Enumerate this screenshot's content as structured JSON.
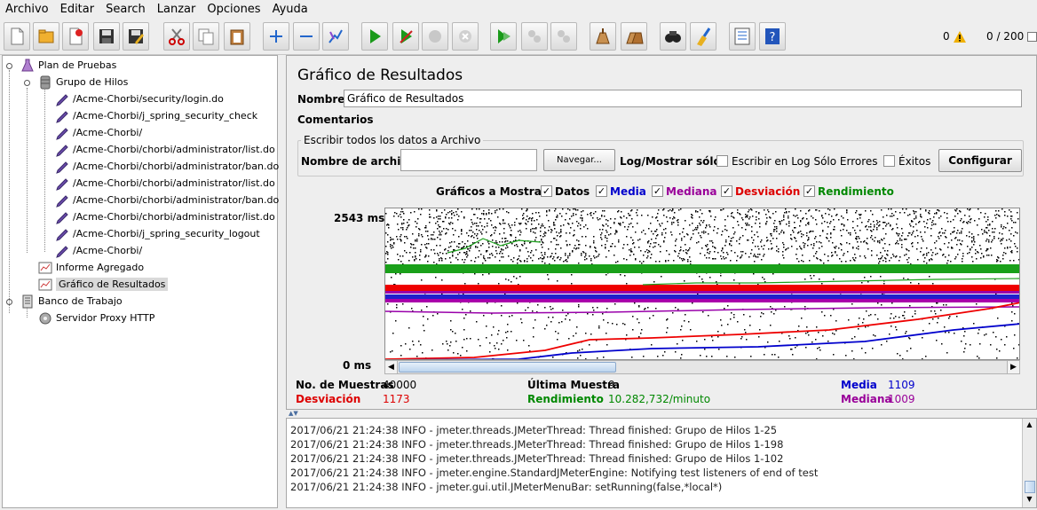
{
  "menu": [
    {
      "label": "Archivo"
    },
    {
      "label": "Editar"
    },
    {
      "label": "Search"
    },
    {
      "label": "Lanzar"
    },
    {
      "label": "Opciones"
    },
    {
      "label": "Ayuda"
    }
  ],
  "toolbar": {
    "icons": [
      "new-icon",
      "open-icon",
      "close-file-icon",
      "save-icon",
      "save-as-icon",
      "cut-icon",
      "copy-icon",
      "paste-icon",
      "expand-icon",
      "collapse-icon",
      "toggle-icon",
      "start-icon",
      "start-no-pause-icon",
      "stop-icon",
      "shutdown-icon",
      "remote-start-icon",
      "remote-stop-icon",
      "remote-shutdown-icon",
      "clear-icon",
      "clear-all-icon",
      "search-icon",
      "reset-search-icon",
      "function-helper-icon",
      "help-icon"
    ],
    "warning_count": "0",
    "threads": "0 / 200"
  },
  "tree": {
    "items": [
      {
        "label": "Plan de Pruebas",
        "icon": "test-plan-icon"
      },
      {
        "label": "Grupo de Hilos",
        "icon": "thread-group-icon"
      },
      {
        "label": "/Acme-Chorbi/security/login.do",
        "icon": "http-sampler-icon"
      },
      {
        "label": "/Acme-Chorbi/j_spring_security_check",
        "icon": "http-sampler-icon"
      },
      {
        "label": "/Acme-Chorbi/",
        "icon": "http-sampler-icon"
      },
      {
        "label": "/Acme-Chorbi/chorbi/administrator/list.do",
        "icon": "http-sampler-icon"
      },
      {
        "label": "/Acme-Chorbi/chorbi/administrator/ban.do",
        "icon": "http-sampler-icon"
      },
      {
        "label": "/Acme-Chorbi/chorbi/administrator/list.do",
        "icon": "http-sampler-icon"
      },
      {
        "label": "/Acme-Chorbi/chorbi/administrator/ban.do",
        "icon": "http-sampler-icon"
      },
      {
        "label": "/Acme-Chorbi/chorbi/administrator/list.do",
        "icon": "http-sampler-icon"
      },
      {
        "label": "/Acme-Chorbi/j_spring_security_logout",
        "icon": "http-sampler-icon"
      },
      {
        "label": "/Acme-Chorbi/",
        "icon": "http-sampler-icon"
      },
      {
        "label": "Informe Agregado",
        "icon": "listener-icon"
      },
      {
        "label": "Gráfico de Resultados",
        "icon": "listener-icon",
        "selected": true
      },
      {
        "label": "Banco de Trabajo",
        "icon": "workbench-icon"
      },
      {
        "label": "Servidor Proxy HTTP",
        "icon": "proxy-icon"
      }
    ]
  },
  "panel": {
    "title": "Gráfico de Resultados",
    "name_label": "Nombre:",
    "name_value": "Gráfico de Resultados",
    "comments_label": "Comentarios",
    "file_group_title": "Escribir todos los datos a Archivo",
    "filename_label": "Nombre de archivo",
    "filename_value": "",
    "browse_button": "Navegar...",
    "log_display_label": "Log/Mostrar sólo:",
    "errors_only_label": "Escribir en Log Sólo Errores",
    "successes_label": "Éxitos",
    "configure_button": "Configurar",
    "graphs_label": "Gráficos a Mostrar",
    "graph_toggles": [
      {
        "label": "Datos",
        "checked": true,
        "color": "#000000"
      },
      {
        "label": "Media",
        "checked": true,
        "color": "#0000cc"
      },
      {
        "label": "Mediana",
        "checked": true,
        "color": "#990099"
      },
      {
        "label": "Desviación",
        "checked": true,
        "color": "#dd0000"
      },
      {
        "label": "Rendimiento",
        "checked": true,
        "color": "#008800"
      }
    ],
    "y_max_label": "2543  ms",
    "y_min_label": "0  ms"
  },
  "stats": {
    "samples_label": "No. de Muestras",
    "samples_value": "40000",
    "last_sample_label": "Última Muestra",
    "last_sample_value": "9",
    "average_label": "Media",
    "average_value": "1109",
    "deviation_label": "Desviación",
    "deviation_value": "1173",
    "throughput_label": "Rendimiento",
    "throughput_value": "10.282,732/minuto",
    "median_label": "Mediana",
    "median_value": "1009"
  },
  "log": {
    "lines": [
      "2017/06/21 21:24:38 INFO  - jmeter.threads.JMeterThread: Thread finished: Grupo de Hilos 1-25",
      "2017/06/21 21:24:38 INFO  - jmeter.threads.JMeterThread: Thread finished: Grupo de Hilos 1-198",
      "2017/06/21 21:24:38 INFO  - jmeter.threads.JMeterThread: Thread finished: Grupo de Hilos 1-102",
      "2017/06/21 21:24:38 INFO  - jmeter.engine.StandardJMeterEngine: Notifying test listeners of end of test",
      "2017/06/21 21:24:38 INFO  - jmeter.gui.util.JMeterMenuBar: setRunning(false,*local*)"
    ]
  }
}
